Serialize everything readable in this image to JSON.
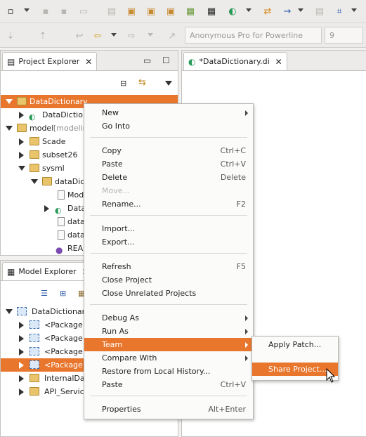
{
  "toolbar": {
    "font_placeholder": "Anonymous Pro for Powerline",
    "font_size": "9"
  },
  "project_explorer": {
    "tab_label": "Project Explorer",
    "tree": [
      {
        "label": "DataDictionary",
        "selected": true
      },
      {
        "label": "DataDictio"
      },
      {
        "label": "model",
        "suffix": "[modelin"
      },
      {
        "label": "Scade"
      },
      {
        "label": "subset26"
      },
      {
        "label": "sysml"
      },
      {
        "label": "dataDict"
      },
      {
        "label": "Mode"
      },
      {
        "label": "Data"
      },
      {
        "label": "data"
      },
      {
        "label": "data"
      },
      {
        "label": "READ"
      }
    ]
  },
  "model_explorer": {
    "tab_label": "Model Explorer",
    "tree": [
      {
        "label": "DataDictionary"
      },
      {
        "label": "<Package In"
      },
      {
        "label": "<Package In"
      },
      {
        "label": "<Package In"
      },
      {
        "label": "<Package In",
        "selected": true
      },
      {
        "label": "InternalDat"
      },
      {
        "label": "API_Services"
      }
    ]
  },
  "editor": {
    "tab_label": "*DataDictionary.di"
  },
  "context_menu": {
    "items": [
      {
        "label": "New",
        "submenu": true
      },
      {
        "label": "Go Into"
      },
      {
        "label": "Copy",
        "shortcut": "Ctrl+C"
      },
      {
        "label": "Paste",
        "shortcut": "Ctrl+V"
      },
      {
        "label": "Delete",
        "shortcut": "Delete"
      },
      {
        "label": "Move...",
        "disabled": true
      },
      {
        "label": "Rename...",
        "shortcut": "F2"
      },
      {
        "label": "Import..."
      },
      {
        "label": "Export..."
      },
      {
        "label": "Refresh",
        "shortcut": "F5"
      },
      {
        "label": "Close Project"
      },
      {
        "label": "Close Unrelated Projects"
      },
      {
        "label": "Debug As",
        "submenu": true
      },
      {
        "label": "Run As",
        "submenu": true
      },
      {
        "label": "Team",
        "submenu": true,
        "highlighted": true
      },
      {
        "label": "Compare With",
        "submenu": true
      },
      {
        "label": "Restore from Local History..."
      },
      {
        "label": "Paste",
        "shortcut": "Ctrl+V"
      },
      {
        "label": "Properties",
        "shortcut": "Alt+Enter"
      }
    ]
  },
  "team_submenu": {
    "items": [
      {
        "label": "Apply Patch..."
      },
      {
        "label": "Share Project...",
        "highlighted": true
      }
    ]
  },
  "colors": {
    "selection": "#e8762d",
    "background": "#f2f1f0"
  }
}
